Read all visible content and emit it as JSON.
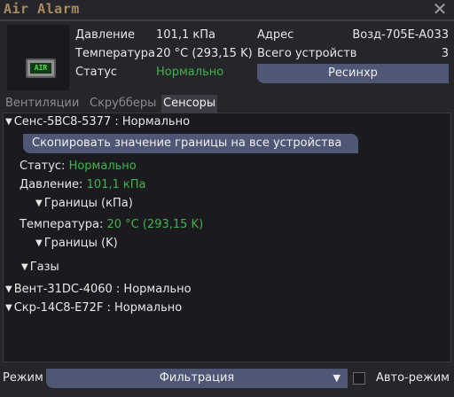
{
  "window": {
    "title": "Air Alarm"
  },
  "summary": {
    "pressure_label": "Давление",
    "pressure_value": "101,1 кПа",
    "temperature_label": "Температура",
    "temperature_value": "20 °C (293,15 K)",
    "status_label": "Статус",
    "status_value": "Нормально",
    "address_label": "Адрес",
    "address_value": "Возд-705E-A033",
    "devices_label": "Всего устройств",
    "devices_value": "3",
    "resync_label": "Ресинхр",
    "device_screen_text": "AIR"
  },
  "tabs": [
    {
      "label": "Вентиляции",
      "active": false
    },
    {
      "label": "Скрубберы",
      "active": false
    },
    {
      "label": "Сенсоры",
      "active": true
    }
  ],
  "sensors": {
    "sensor1_header": "Сенс-5BC8-5377 : Нормально",
    "copy_button": "Скопировать значение границы на все устройства",
    "status_label": "Статус:",
    "status_value": "Нормально",
    "pressure_label": "Давление:",
    "pressure_value": "101,1 кПа",
    "pressure_limits": "Границы (кПа)",
    "temperature_label": "Температура:",
    "temperature_value": "20 °C (293,15 K)",
    "temperature_limits": "Границы (K)",
    "gases": "Газы",
    "vent_header": "Вент-31DC-4060 : Нормально",
    "scrubber_header": "Скр-14C8-E72F : Нормально"
  },
  "footer": {
    "mode_label": "Режим",
    "mode_value": "Фильтрация",
    "auto_label": "Авто-режим",
    "auto_checked": false
  },
  "colors": {
    "accent_title": "#a88b5e",
    "status_ok": "#3eb54a",
    "button_bg": "#4e5775"
  }
}
